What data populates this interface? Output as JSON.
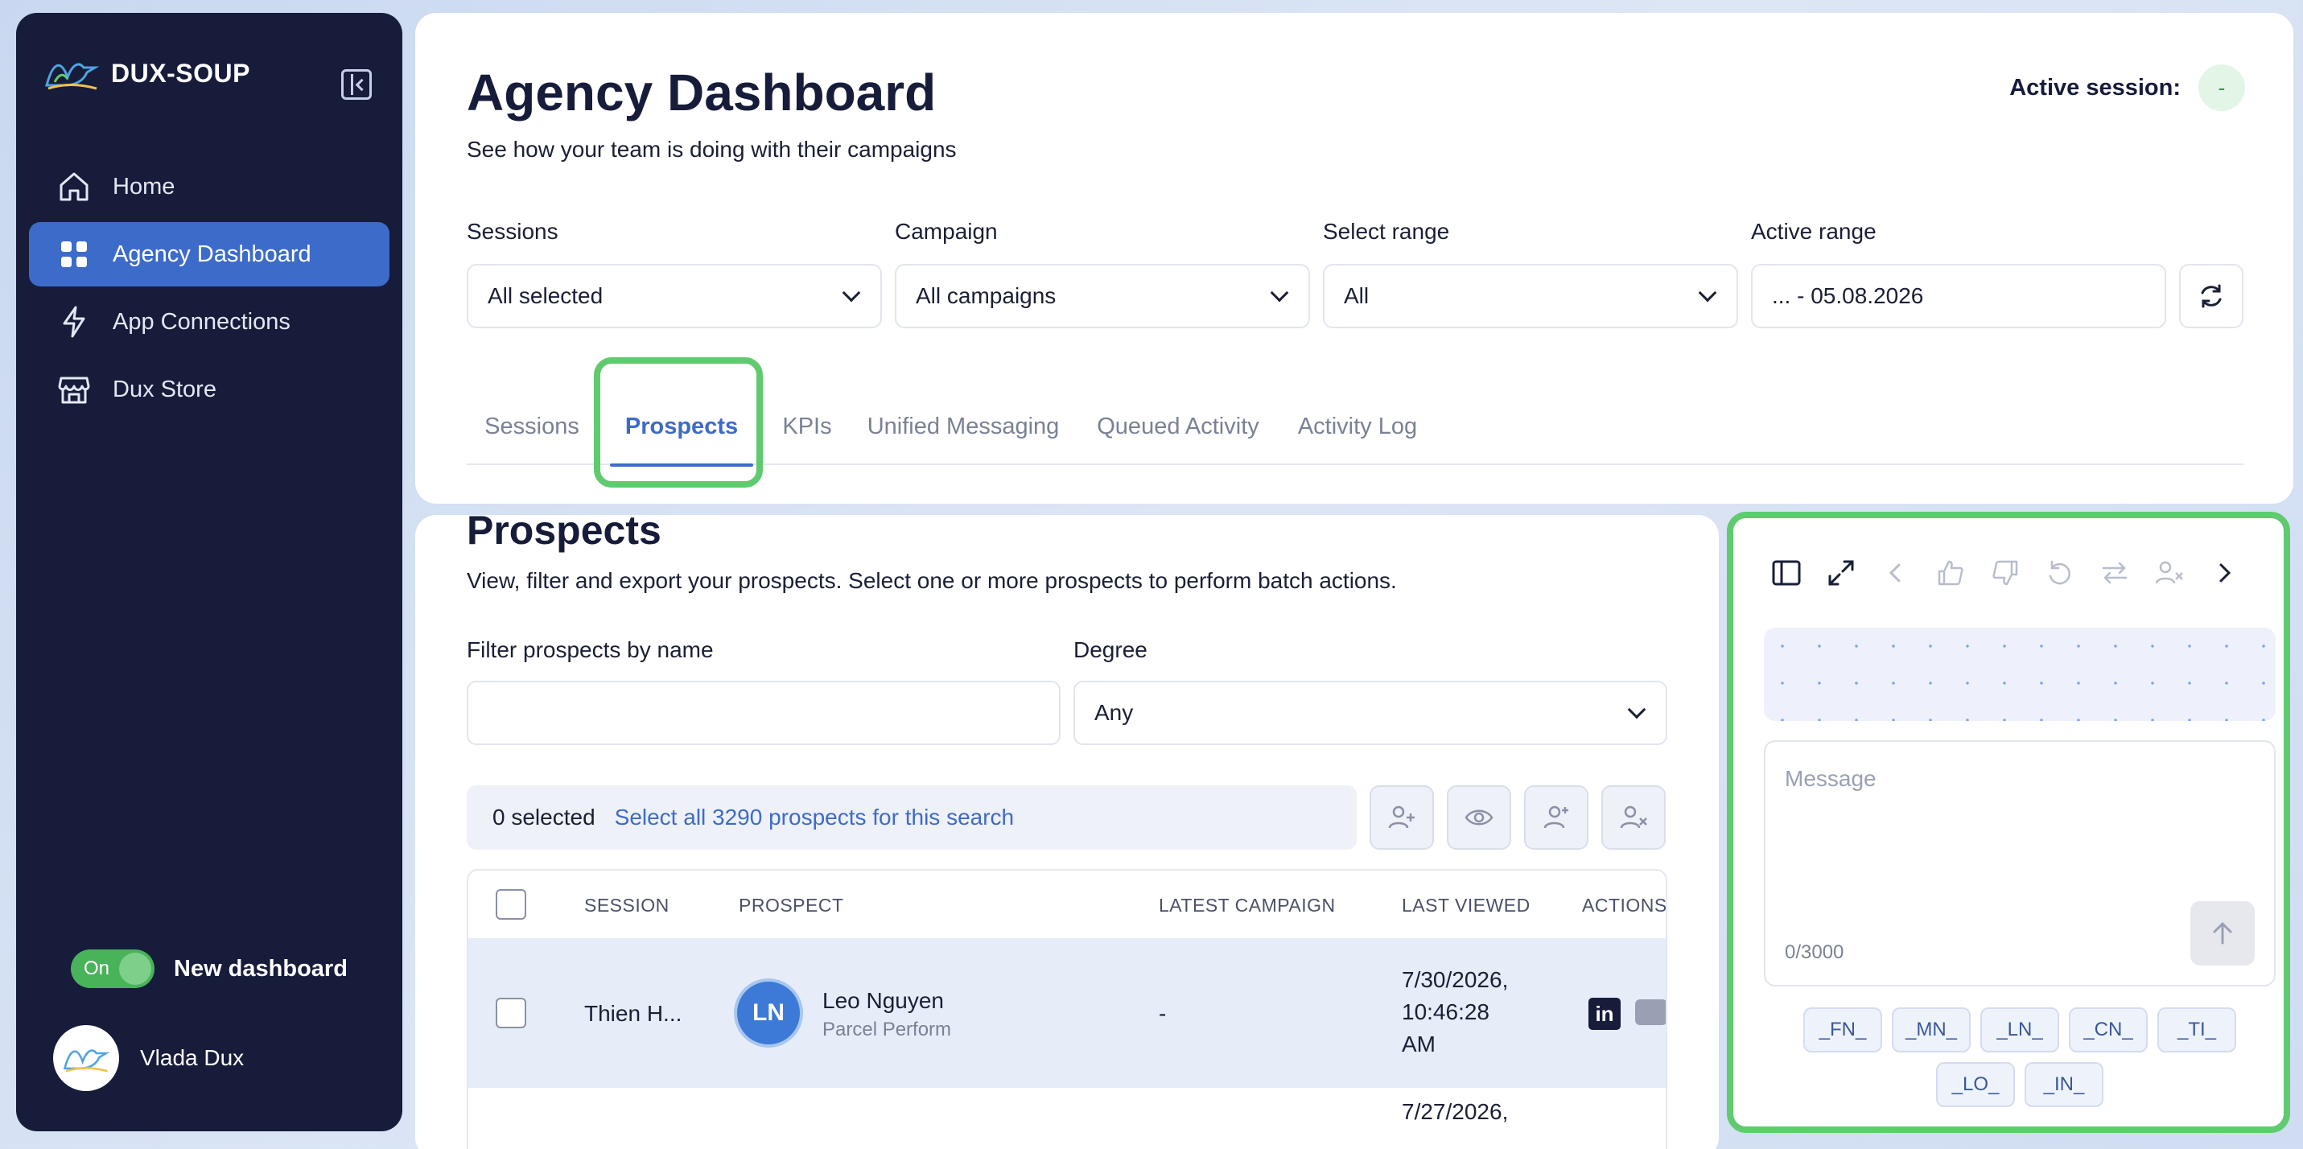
{
  "brand": {
    "name": "DUX-SOUP"
  },
  "sidebar": {
    "items": [
      {
        "label": "Home",
        "icon": "home-icon"
      },
      {
        "label": "Agency Dashboard",
        "icon": "grid-icon",
        "active": true
      },
      {
        "label": "App Connections",
        "icon": "lightning-icon"
      },
      {
        "label": "Dux Store",
        "icon": "store-icon"
      }
    ],
    "toggle": {
      "state_label": "On",
      "label": "New dashboard"
    },
    "user": {
      "name": "Vlada Dux"
    }
  },
  "header": {
    "title": "Agency Dashboard",
    "subtitle": "See how your team is doing with their campaigns",
    "session_label": "Active session:",
    "session_value": "-"
  },
  "filters": [
    {
      "label": "Sessions",
      "value": "All selected"
    },
    {
      "label": "Campaign",
      "value": "All campaigns"
    },
    {
      "label": "Select range",
      "value": "All"
    },
    {
      "label": "Active range",
      "value": "... - 05.08.2026"
    }
  ],
  "tabs": [
    {
      "label": "Sessions"
    },
    {
      "label": "Prospects",
      "active": true
    },
    {
      "label": "KPIs"
    },
    {
      "label": "Unified Messaging"
    },
    {
      "label": "Queued Activity"
    },
    {
      "label": "Activity Log"
    }
  ],
  "prospects": {
    "title": "Prospects",
    "subtitle": "View, filter and export your prospects. Select one or more prospects to perform batch actions.",
    "filter_name_label": "Filter prospects by name",
    "filter_name_value": "",
    "degree_label": "Degree",
    "degree_value": "Any",
    "selected_text": "0 selected",
    "select_all_text": "Select all 3290 prospects for this search",
    "columns": [
      "SESSION",
      "PROSPECT",
      "LATEST CAMPAIGN",
      "LAST VIEWED",
      "ACTIONS"
    ],
    "rows": [
      {
        "session": "Thien H...",
        "initials": "LN",
        "name": "Leo Nguyen",
        "company": "Parcel Perform",
        "campaign": "-",
        "last_viewed_1": "7/30/2026,",
        "last_viewed_2": "10:46:28",
        "last_viewed_3": "AM"
      },
      {
        "last_viewed_1": "7/27/2026,"
      }
    ]
  },
  "chat": {
    "message_placeholder": "Message",
    "char_count": "0/3000",
    "tokens": [
      "_FN_",
      "_MN_",
      "_LN_",
      "_CN_",
      "_TI_",
      "_LO_",
      "_IN_"
    ]
  },
  "colors": {
    "sidebar_bg": "#161c3a",
    "accent": "#3d6bc9",
    "highlight": "#5fca6e"
  }
}
